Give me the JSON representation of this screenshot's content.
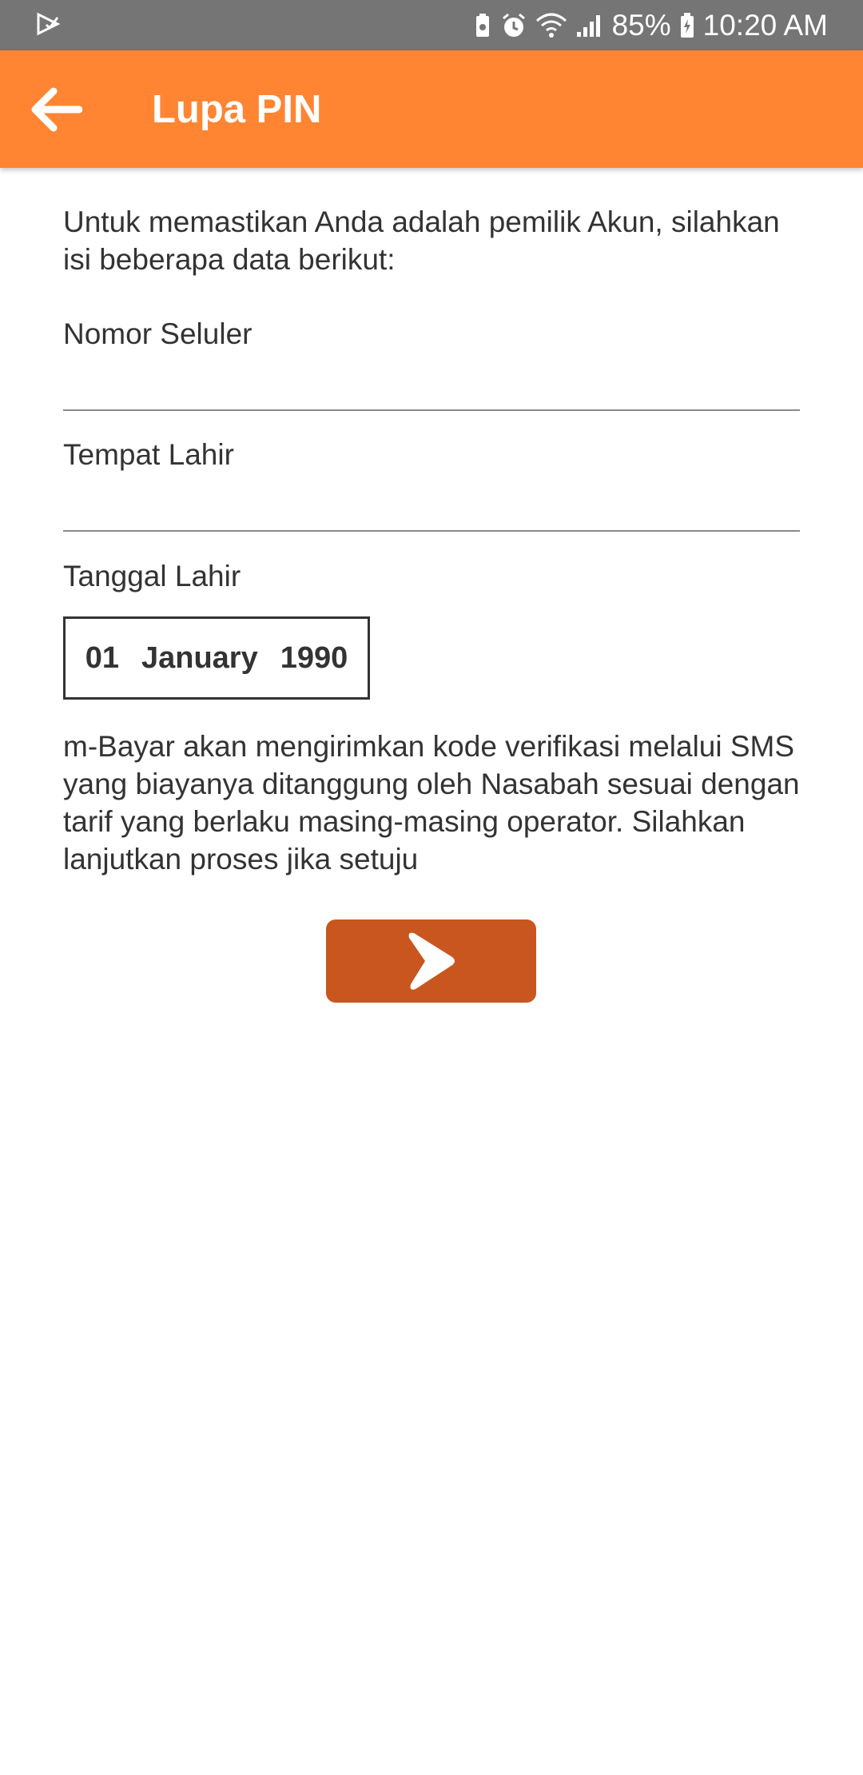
{
  "status_bar": {
    "battery": "85%",
    "time": "10:20 AM",
    "icons": [
      "notification-check-icon",
      "battery-saver-icon",
      "alarm-icon",
      "wifi-icon",
      "signal-icon",
      "battery-charging-icon"
    ]
  },
  "app_bar": {
    "title": "Lupa PIN",
    "back_icon": "arrow-left-icon",
    "color": "#ff8533"
  },
  "form": {
    "intro": "Untuk memastikan Anda adalah pemilik Akun, silahkan isi beberapa data berikut:",
    "phone_label": "Nomor Seluler",
    "phone_value": "",
    "birthplace_label": "Tempat Lahir",
    "birthplace_value": "",
    "birthdate_label": "Tanggal Lahir",
    "birthdate": {
      "day": "01",
      "month": "January",
      "year": "1990"
    },
    "notice": "m-Bayar akan mengirimkan kode verifikasi melalui SMS yang biayanya ditanggung oleh Nasabah sesuai dengan tarif yang berlaku masing-masing operator. Silahkan lanjutkan proses jika setuju",
    "next_icon": "chevron-right-icon",
    "button_color": "#c9561f"
  }
}
